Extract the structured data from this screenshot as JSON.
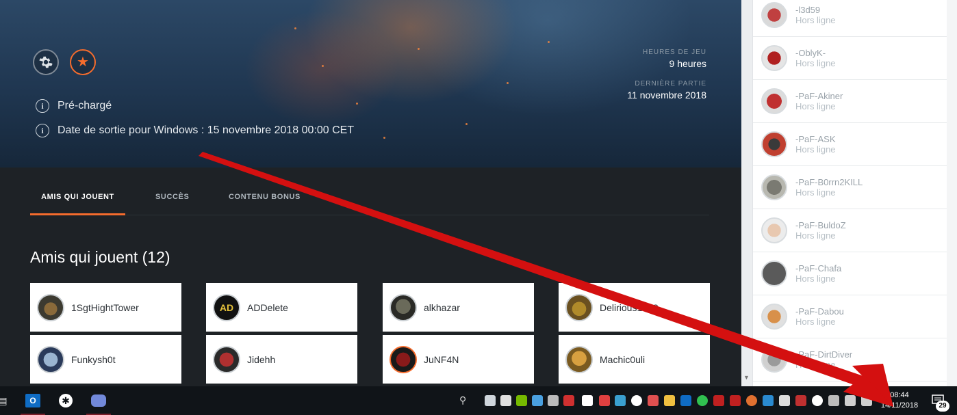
{
  "hero": {
    "preloaded": "Pré-chargé",
    "release": "Date de sortie pour Windows : 15 novembre 2018 00:00 CET",
    "playtime_label": "HEURES DE JEU",
    "playtime_value": "9 heures",
    "lastplayed_label": "DERNIÈRE PARTIE",
    "lastplayed_value": "11 novembre 2018",
    "icons": {
      "settings": "gear-icon",
      "favorite": "star-icon",
      "info": "info-icon"
    },
    "accent": "#f56c2d"
  },
  "tabs": [
    {
      "label": "AMIS QUI JOUENT",
      "active": true
    },
    {
      "label": "SUCCÈS",
      "active": false
    },
    {
      "label": "CONTENU BONUS",
      "active": false
    }
  ],
  "friends_section": {
    "title": "Amis qui jouent (12)",
    "friends": [
      {
        "name": "1SgtHightTower"
      },
      {
        "name": "ADDelete"
      },
      {
        "name": "alkhazar"
      },
      {
        "name": "Delirious1708"
      },
      {
        "name": "Funkysh0t"
      },
      {
        "name": "Jidehh"
      },
      {
        "name": "JuNF4N"
      },
      {
        "name": "Machic0uli"
      }
    ]
  },
  "sidebar": {
    "items": [
      {
        "name": "-l3d59",
        "status": "Hors ligne"
      },
      {
        "name": "-OblyK-",
        "status": "Hors ligne"
      },
      {
        "name": "-PaF-Akiner",
        "status": "Hors ligne"
      },
      {
        "name": "-PaF-ASK",
        "status": "Hors ligne"
      },
      {
        "name": "-PaF-B0rrn2KILL",
        "status": "Hors ligne"
      },
      {
        "name": "-PaF-BuldoZ",
        "status": "Hors ligne"
      },
      {
        "name": "-PaF-Chafa",
        "status": "Hors ligne"
      },
      {
        "name": "-PaF-Dabou",
        "status": "Hors ligne"
      },
      {
        "name": "-PaF-DirtDiver",
        "status": "Hors ligne"
      }
    ]
  },
  "taskbar": {
    "time": "08:44",
    "date": "14/11/2018",
    "notification_count": "29",
    "apps": [
      "outlook-icon",
      "slack-icon",
      "discord-icon"
    ]
  }
}
